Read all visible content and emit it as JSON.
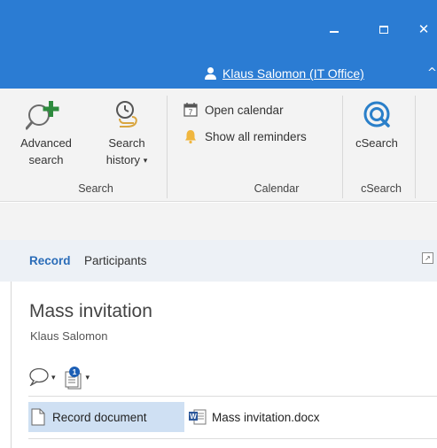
{
  "window": {
    "minimize_icon": "minimize-icon",
    "maximize_icon": "maximize-icon",
    "close_glyph": "✕"
  },
  "user": {
    "name": "Klaus Salomon (IT Office)",
    "icon": "user-icon"
  },
  "ribbon": {
    "groups": {
      "search": {
        "label": "Search",
        "advanced": {
          "line1": "Advanced",
          "line2": "search",
          "icon": "search-plus-icon"
        },
        "history": {
          "line1": "Search",
          "line2": "history",
          "caret": "▾",
          "icon": "search-history-icon"
        }
      },
      "calendar": {
        "label": "Calendar",
        "open_calendar": {
          "label": "Open calendar",
          "icon": "calendar-icon"
        },
        "reminders": {
          "label": "Show all reminders",
          "icon": "bell-icon"
        }
      },
      "csearch": {
        "label": "cSearch",
        "button": {
          "label": "cSearch",
          "icon": "csearch-icon"
        }
      }
    }
  },
  "tabs": [
    {
      "label": "Record",
      "active": true
    },
    {
      "label": "Participants",
      "active": false
    }
  ],
  "record": {
    "title": "Mass invitation",
    "author": "Klaus Salomon",
    "tools": {
      "comment_icon": "speech-bubble-icon",
      "document_icon": "documents-icon",
      "document_badge": "1"
    },
    "attachments": {
      "record_document": {
        "label": "Record document",
        "icon": "document-icon"
      },
      "file": {
        "name": "Mass invitation.docx",
        "icon": "word-file-icon"
      }
    }
  },
  "colors": {
    "titlebar": "#2b7cd3",
    "accent": "#2a6cb8",
    "selection": "#cfe0f3",
    "badge": "#1d5fb5"
  }
}
